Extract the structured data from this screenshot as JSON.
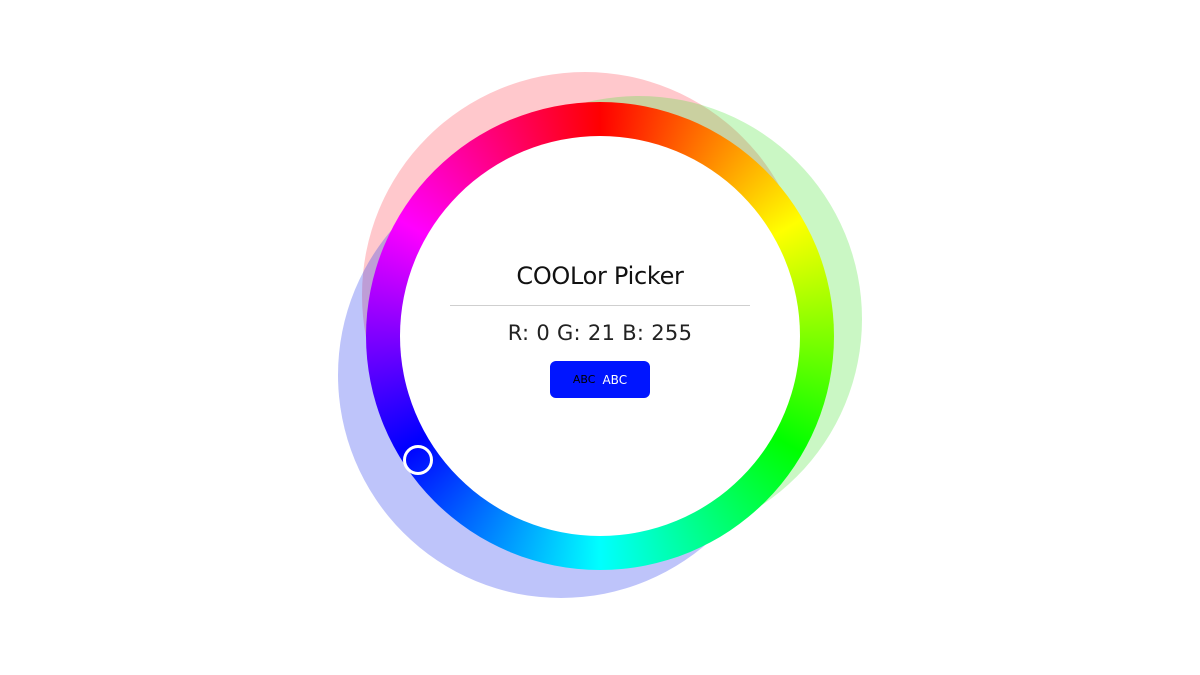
{
  "picker": {
    "title": "COOLor Picker",
    "readout": "R: 0 G: 21 B: 255",
    "selected_color": "#0015ff",
    "preview": {
      "dark_text": "ABC",
      "light_text": "ABC"
    }
  },
  "channel_blobs": {
    "red": "#ff555f",
    "green": "#50e63c",
    "blue": "#283cf0"
  }
}
